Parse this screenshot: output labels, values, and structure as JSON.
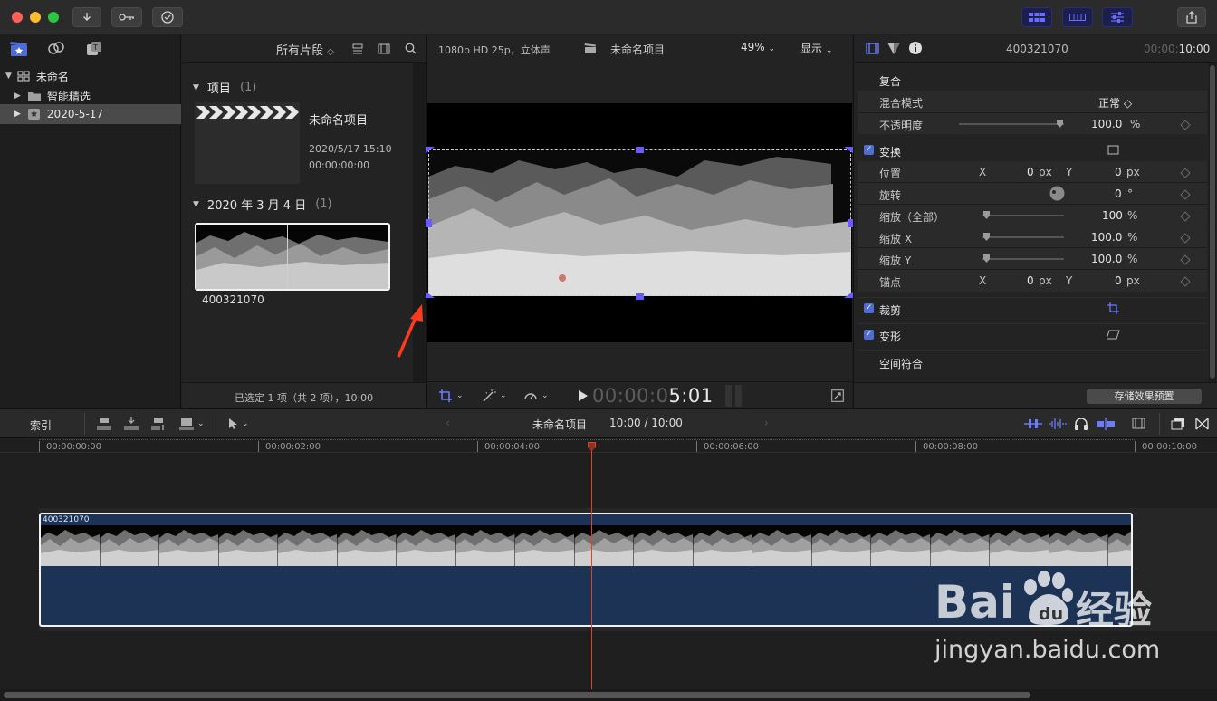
{
  "titlebar": {
    "buttons": [
      "download-icon",
      "key-icon",
      "check-circle-icon"
    ],
    "right_buttons": [
      "grid-icon",
      "filmstrip-icon",
      "sliders-icon"
    ],
    "share": "share-icon"
  },
  "library": {
    "items": [
      {
        "label": "未命名",
        "icon": "library-icon"
      },
      {
        "label": "智能精选",
        "icon": "folder-icon"
      },
      {
        "label": "2020-5-17",
        "icon": "event-star-icon"
      }
    ]
  },
  "browser": {
    "filter": "所有片段",
    "section_projects": "项目",
    "section_projects_count": "(1)",
    "project_name": "未命名项目",
    "project_date": "2020/5/17 15:10",
    "project_duration": "00:00:00:00",
    "section_date": "2020 年 3 月 4 日",
    "section_date_count": "(1)",
    "clip_name": "400321070",
    "status": "已选定 1 项（共 2 项），10:00"
  },
  "viewer": {
    "format": "1080p HD 25p，立体声",
    "project": "未命名项目",
    "zoom": "49%",
    "display": "显示",
    "timecode_dim": "00:00:0",
    "timecode_bright": "5:01"
  },
  "inspector": {
    "clip_name": "400321070",
    "time_dim": "00:00:",
    "time_bright": "10:00",
    "composite": "复合",
    "blend_mode_label": "混合模式",
    "blend_mode_value": "正常 ◇",
    "opacity_label": "不透明度",
    "opacity_value": "100.0",
    "opacity_unit": "%",
    "opacity_level": 1.0,
    "transform": "变换",
    "position_label": "位置",
    "x": "X",
    "y": "Y",
    "pos_x": "0",
    "pos_y": "0",
    "px": "px",
    "rotation_label": "旋转",
    "rotation_value": "0",
    "deg": "°",
    "scale_all_label": "缩放（全部）",
    "scale_all_value": "100",
    "scale_x_label": "缩放 X",
    "scale_x_value": "100.0",
    "scale_y_label": "缩放 Y",
    "scale_y_value": "100.0",
    "pct": "%",
    "anchor_label": "锚点",
    "anchor_x": "0",
    "anchor_y": "0",
    "crop": "裁剪",
    "distort": "变形",
    "spatial": "空间符合",
    "save_preset": "存储效果预置"
  },
  "timeline": {
    "index": "索引",
    "project": "未命名项目",
    "duration": "10:00 / 10:00",
    "ruler": [
      "00:00:00:00",
      "00:00:02:00",
      "00:00:04:00",
      "00:00:06:00",
      "00:00:08:00",
      "00:00:10:00"
    ],
    "clip_name": "400321070",
    "playhead_seconds": 5.0
  },
  "watermark": {
    "text1": "Bai",
    "text2": "经验",
    "url": "jingyan.baidu.com"
  },
  "colors": {
    "accent": "#6b5bff",
    "clip_blue": "#1d3356",
    "check": "#4f6ed4",
    "arrow": "#ff3b1f",
    "playhead": "#d9442a"
  }
}
